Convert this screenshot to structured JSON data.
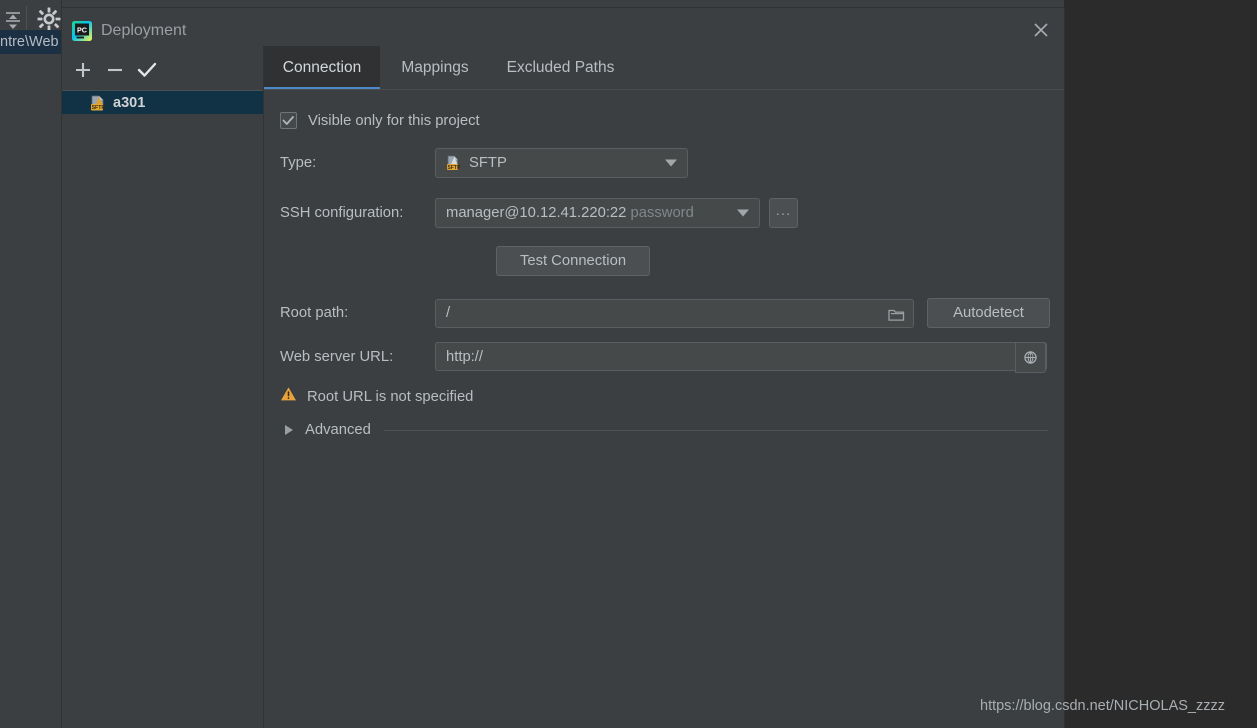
{
  "background_ide": {
    "collapse_icon": "collapse-all-icon",
    "settings_icon": "gear-icon",
    "breadcrumb_text": "ntre\\Web"
  },
  "dialog": {
    "title": "Deployment",
    "logo_icon": "pycharm-logo-icon",
    "close_icon": "close-icon",
    "toolbar": {
      "add_label": "+",
      "remove_label": "−",
      "check_label": "✓",
      "add_icon": "plus-icon",
      "remove_icon": "minus-icon",
      "check_icon": "checkmark-icon"
    },
    "servers": [
      {
        "name": "a301",
        "icon": "sftp-server-icon",
        "selected": true
      }
    ],
    "tabs": [
      {
        "label": "Connection",
        "active": true
      },
      {
        "label": "Mappings",
        "active": false
      },
      {
        "label": "Excluded Paths",
        "active": false
      }
    ],
    "connection": {
      "visible_only_checkbox": {
        "label": "Visible only for this project",
        "checked": true
      },
      "type": {
        "label": "Type:",
        "value": "SFTP",
        "icon": "sftp-icon",
        "dropdown_icon": "chevron-down-icon"
      },
      "ssh_configuration": {
        "label": "SSH configuration:",
        "value": "manager@10.12.41.220:22",
        "auth_hint": "password",
        "dropdown_icon": "chevron-down-icon",
        "browse_label": "...",
        "browse_icon": "ellipsis-icon"
      },
      "test_connection": {
        "label": "Test Connection"
      },
      "root_path": {
        "label": "Root path:",
        "value": "/",
        "browse_icon": "folder-icon",
        "autodetect_label": "Autodetect"
      },
      "web_server_url": {
        "label": "Web server URL:",
        "value": "http://",
        "open_icon": "globe-icon"
      },
      "warning": {
        "icon": "warning-triangle-icon",
        "text": "Root URL is not specified",
        "color": "#e8a33d"
      },
      "advanced": {
        "label": "Advanced",
        "expanded": false,
        "toggle_icon": "chevron-right-icon"
      }
    }
  },
  "watermark": "https://blog.csdn.net/NICHOLAS_zzzz",
  "colors": {
    "dialog_bg": "#3c3f41",
    "page_bg": "#2b2b2b",
    "accent": "#4a88c7",
    "selection": "#113144",
    "warning": "#e8a33d",
    "text": "#b9bec2"
  }
}
